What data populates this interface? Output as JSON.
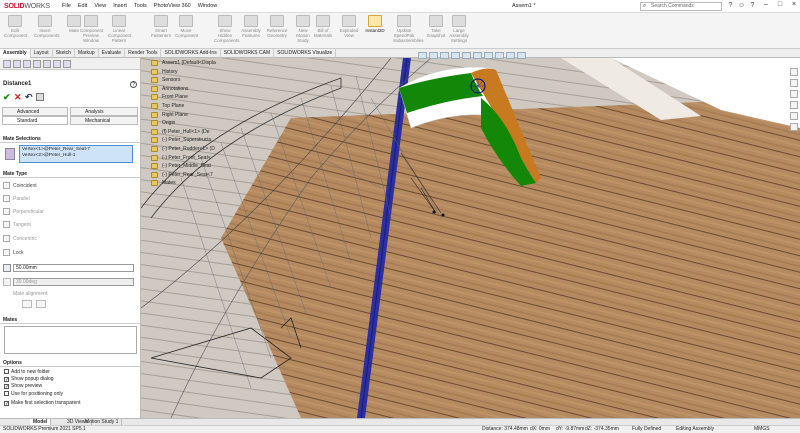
{
  "app": {
    "logo_brand": "SOLID",
    "logo_rest": "WORKS",
    "doc_name": "Assem1 *"
  },
  "menu": [
    "File",
    "Edit",
    "View",
    "Insert",
    "Tools",
    "PhotoView 360",
    "Window"
  ],
  "search": {
    "placeholder": "Search Commands"
  },
  "ribbon": [
    {
      "label": "Edit Component"
    },
    {
      "label": "Insert Components"
    },
    {
      "label": "Mate"
    },
    {
      "label": "Component Preview Window"
    },
    {
      "label": "Linear Component Pattern"
    },
    {
      "label": "Smart Fasteners"
    },
    {
      "label": "Move Component"
    },
    {
      "label": "Show Hidden Components"
    },
    {
      "label": "Assembly Features"
    },
    {
      "label": "Reference Geometry"
    },
    {
      "label": "New Motion Study"
    },
    {
      "label": "Bill of Materials"
    },
    {
      "label": "Exploded View"
    },
    {
      "label": "Instant3D"
    },
    {
      "label": "Update SpeedPak Subassemblies"
    },
    {
      "label": "Take Snapshot"
    },
    {
      "label": "Large Assembly Settings"
    }
  ],
  "command_tabs": [
    "Assembly",
    "Layout",
    "Sketch",
    "Markup",
    "Evaluate",
    "Render Tools",
    "SOLIDWORKS Add-Ins",
    "SOLIDWORKS CAM",
    "SOLIDWORKS Visualize"
  ],
  "property_manager": {
    "title": "Distance1",
    "help": "?",
    "tabs": {
      "advanced": "Advanced",
      "analysis": "Analysis",
      "standard": "Standard",
      "mechanical": "Mechanical"
    },
    "mate_selections_header": "Mate Selections",
    "selections": [
      "Vertex<1>@Peter_Rear_Seat-7",
      "Vertex<2>@Peter_Hull-1"
    ],
    "mate_type_header": "Mate Type",
    "mate_types": [
      "Coincident",
      "Parallel",
      "Perpendicular",
      "Tangent",
      "Concentric",
      "Lock"
    ],
    "distance_value": "50.00mm",
    "angle_value": "30.00deg",
    "mate_alignment": "Mate alignment:",
    "mates_header": "Mates",
    "options_header": "Options",
    "options": [
      {
        "label": "Add to new folder",
        "checked": false
      },
      {
        "label": "Show popup dialog",
        "checked": true
      },
      {
        "label": "Show preview",
        "checked": true
      },
      {
        "label": "Use for positioning only",
        "checked": false
      },
      {
        "label": "Make first selection transparent",
        "checked": true
      }
    ]
  },
  "tree": [
    "Assem1 (Default<Displa",
    "History",
    "Sensors",
    "Annotations",
    "Front Plane",
    "Top Plane",
    "Right Plane",
    "Origin",
    "(f) Peter_Hull<1> (De",
    "(-) Peter_Superstructu",
    "(-) Peter_Rudder<1> (D",
    "(-) Peter_Front_Seat<",
    "(-) Peter_Middle_Seat",
    "(-) Peter_Rear_Seat<7",
    "Mates"
  ],
  "bottom_tabs": [
    "Model",
    "3D Views",
    "Motion Study 1"
  ],
  "status": {
    "product": "SOLIDWORKS Premium 2021 SP5.1",
    "distance": "Distance: 374.48mm",
    "dx": "dX: 0mm",
    "dy": "dY: -9.87mm",
    "dz": "dZ: -374.35mm",
    "state": "Fully Defined",
    "mode": "Editing Assembly",
    "units": "MMGS"
  },
  "colors": {
    "accent": "#c8102e",
    "selection": "#cfe3f7",
    "flag_saffron": "#ff9933",
    "flag_green": "#138808",
    "flag_chakra": "#000080"
  }
}
